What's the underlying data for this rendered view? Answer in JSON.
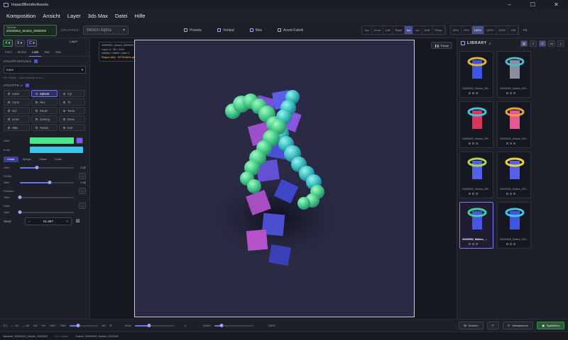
{
  "window": {
    "title": "ImpactBlenderAssets",
    "min": "–",
    "max": "☐",
    "close": "✕"
  },
  "menu": [
    "Komposition",
    "Ansicht",
    "Layer",
    "3ds Max",
    "Datei",
    "Hilfe"
  ],
  "toolbar": {
    "variant_top": "Variante",
    "variant_name": "20260502_Motion_0000009",
    "section_label": "GRUPPEN",
    "preset_dropdown": "Motion Alpha",
    "buttons": [
      "Presets",
      "Verlauf",
      "Max",
      "Asset-Fabrik"
    ],
    "views": [
      "Top",
      "Front",
      "Left",
      "Right",
      "Iso",
      "Iso",
      "VnB",
      "Persp"
    ],
    "active_view": 4,
    "zooms": [
      "50%",
      "75%",
      "100%",
      "125%",
      "150%",
      "195"
    ],
    "active_zoom": 2,
    "zoom_extra": "Fit"
  },
  "left": {
    "top_buttons": [
      "4 ●",
      "8 ●",
      "C ●"
    ],
    "layer_label": "Layer",
    "tabs": [
      "Form",
      "Motion",
      "Look",
      "Max",
      "Max"
    ],
    "active_tab": 2,
    "grouping_title": "GRUPPIERUNG",
    "grouping_select": "none",
    "hint": "Ein Objekt — keine Motion in Lo...",
    "group_title": "GRUPPE A",
    "shapes": [
      "Cube",
      "Sphere",
      "Cyl",
      "Cone",
      "Hex",
      "Tri",
      "Oct",
      "Raute",
      "Torus",
      "Linse",
      "Zenkeg",
      "Dreie",
      "Stbe",
      "Pyram",
      "Keil"
    ],
    "active_shape": 1,
    "color_start_label": "Start",
    "color_end_label": "Ende",
    "color_start": "#4be58a",
    "color_end": "#3fc5e8",
    "ease_tabs": [
      "Linear",
      "Spiegel",
      "Stufen",
      "Zufall"
    ],
    "active_ease": 0,
    "jitter1_label": "Jitter",
    "jitter1_value": "0.32",
    "jitter1_fill": 0.32,
    "size_label": "Größe",
    "size_jitter_label": "Jitter",
    "size_jitter_value": "0.40",
    "size_fill": 0.55,
    "pos_label": "Position",
    "pos_jitter_label": "Jitter",
    "pos_fill": 0.0,
    "hue_label": "Hölle",
    "hue_jitter_label": "Jitter",
    "hue_fill": 0.0,
    "dots": "...",
    "seed_label": "Seed",
    "seed_value": "51.687",
    "minus": "−",
    "plus": "+"
  },
  "viewport": {
    "info_line1": "20260502_Motion_0000009",
    "info_line2": "Layer: A · 36 × 1024",
    "info_line3": "Intadhe / visible / wave-2",
    "info_warn": "Etappe aktiv · 99 Primitive gesamt",
    "pause_label": "Pause"
  },
  "library": {
    "title": "LIBRARY",
    "count": "8",
    "items": [
      {
        "name": "20260502_Motion_000...",
        "c1": "#3f57e0",
        "c2": "#e0b23c"
      },
      {
        "name": "20260502_Motion_000...",
        "c1": "#8a8fa0",
        "c2": "#4fb8c9"
      },
      {
        "name": "20260502_Motion_000...",
        "c1": "#d8355c",
        "c2": "#42c4e0"
      },
      {
        "name": "20260502_Motion_000...",
        "c1": "#e65a8f",
        "c2": "#e8a13a"
      },
      {
        "name": "20260502_Motion_000...",
        "c1": "#5560e8",
        "c2": "#a6d94c"
      },
      {
        "name": "20260502_Motion_000...",
        "c1": "#5560e8",
        "c2": "#e8d43a"
      },
      {
        "name": "20260502_Motion_...",
        "c1": "#4a55e0",
        "c2": "#3fd0a0"
      },
      {
        "name": "20260408_Motion_000...",
        "c1": "#3f57e0",
        "c2": "#3fc5e8"
      }
    ],
    "active": 6
  },
  "bottom": {
    "nums": [
      "↺ 2",
      "← -90",
      "→ -45",
      "+45",
      "+90",
      "+180°",
      "+360"
    ],
    "rot_value": "-64°",
    "height_label": "Höhe",
    "height_value": "0",
    "size_label": "Größe",
    "size_value": "100%",
    "btn_dice": "Würfeln",
    "btn_refresh": "Aktualisieren",
    "btn_save": "Speichern"
  },
  "status": {
    "left": "Variante: 20260502_Motion_0000009",
    "mid": "99 1 visible",
    "right": "Zuletzt: 20260502_Motion_0000009"
  }
}
